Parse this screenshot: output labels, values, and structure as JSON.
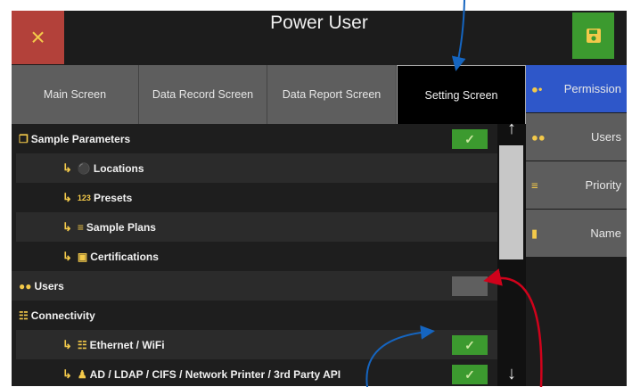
{
  "header": {
    "title": "Power User",
    "close_icon": "×",
    "save_icon": "save-icon"
  },
  "tabs": [
    {
      "label": "Main Screen",
      "active": false
    },
    {
      "label": "Data Record Screen",
      "active": false
    },
    {
      "label": "Data Report Screen",
      "active": false
    },
    {
      "label": "Setting Screen",
      "active": true
    }
  ],
  "side_nav": [
    {
      "label": "Permission",
      "icon": "user-key-icon",
      "active": true
    },
    {
      "label": "Users",
      "icon": "users-icon",
      "active": false
    },
    {
      "label": "Priority",
      "icon": "priority-icon",
      "active": false
    },
    {
      "label": "Name",
      "icon": "tag-icon",
      "active": false
    }
  ],
  "permissions": [
    {
      "label": "Sample Parameters",
      "icon": "sample-parameters-icon",
      "indent": false,
      "checked": true
    },
    {
      "label": "Locations",
      "icon": "location-pin-icon",
      "indent": true,
      "checked": null
    },
    {
      "label": "Presets",
      "icon": "123-icon",
      "indent": true,
      "checked": null
    },
    {
      "label": "Sample Plans",
      "icon": "list-icon",
      "indent": true,
      "checked": null
    },
    {
      "label": "Certifications",
      "icon": "certificate-icon",
      "indent": true,
      "checked": null
    },
    {
      "label": "Users",
      "icon": "users-icon",
      "indent": false,
      "checked": false
    },
    {
      "label": "Connectivity",
      "icon": "network-icon",
      "indent": false,
      "checked": null
    },
    {
      "label": "Ethernet / WiFi",
      "icon": "network-icon",
      "indent": true,
      "checked": true
    },
    {
      "label": "AD / LDAP / CIFS / Network Printer / 3rd Party API",
      "icon": "user-network-icon",
      "indent": true,
      "checked": true
    }
  ],
  "colors": {
    "accent_blue": "#2e57c9",
    "check_green": "#3c9a2f",
    "close_red": "#b3413a",
    "icon_yellow": "#f3c94a",
    "annotation_blue": "#1565c0",
    "annotation_red": "#d0021b"
  }
}
